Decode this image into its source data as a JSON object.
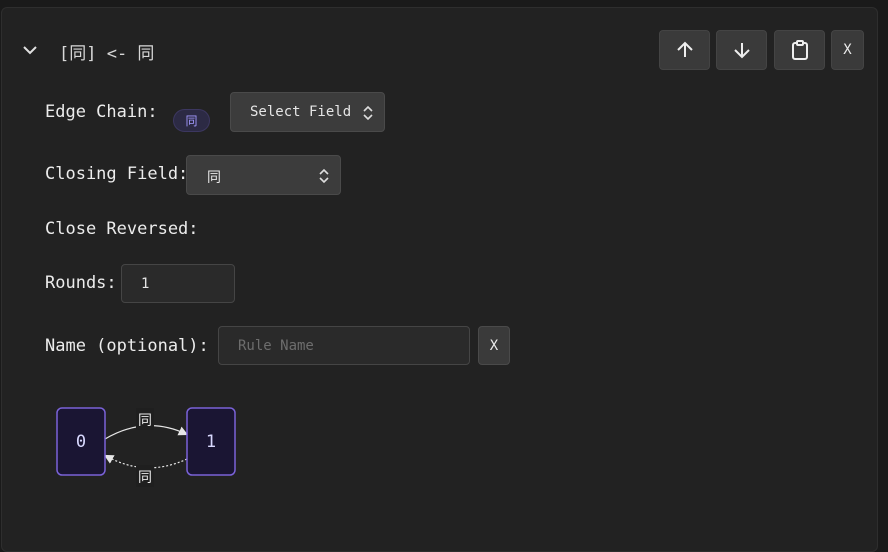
{
  "header": {
    "title": "[同] <- 同",
    "buttons": {
      "move_up": "up-arrow",
      "move_down": "down-arrow",
      "copy": "clipboard",
      "close_label": "X"
    }
  },
  "form": {
    "edge_chain": {
      "label": "Edge Chain:",
      "badge": "同",
      "select_value": "Select Field"
    },
    "closing_field": {
      "label": "Closing Field:",
      "select_value": "同"
    },
    "close_reversed": {
      "label": "Close Reversed:"
    },
    "rounds": {
      "label": "Rounds:",
      "value": "1"
    },
    "name": {
      "label": "Name (optional):",
      "placeholder": "Rule Name",
      "clear_label": "X"
    }
  },
  "graph": {
    "nodes": [
      "0",
      "1"
    ],
    "edges": [
      {
        "from": "0",
        "to": "1",
        "label": "同",
        "style": "solid"
      },
      {
        "from": "1",
        "to": "0",
        "label": "同",
        "style": "dashed"
      }
    ]
  },
  "colors": {
    "node_fill": "#1a1533",
    "node_border": "#7a62d8",
    "accent": "#a39aff"
  }
}
